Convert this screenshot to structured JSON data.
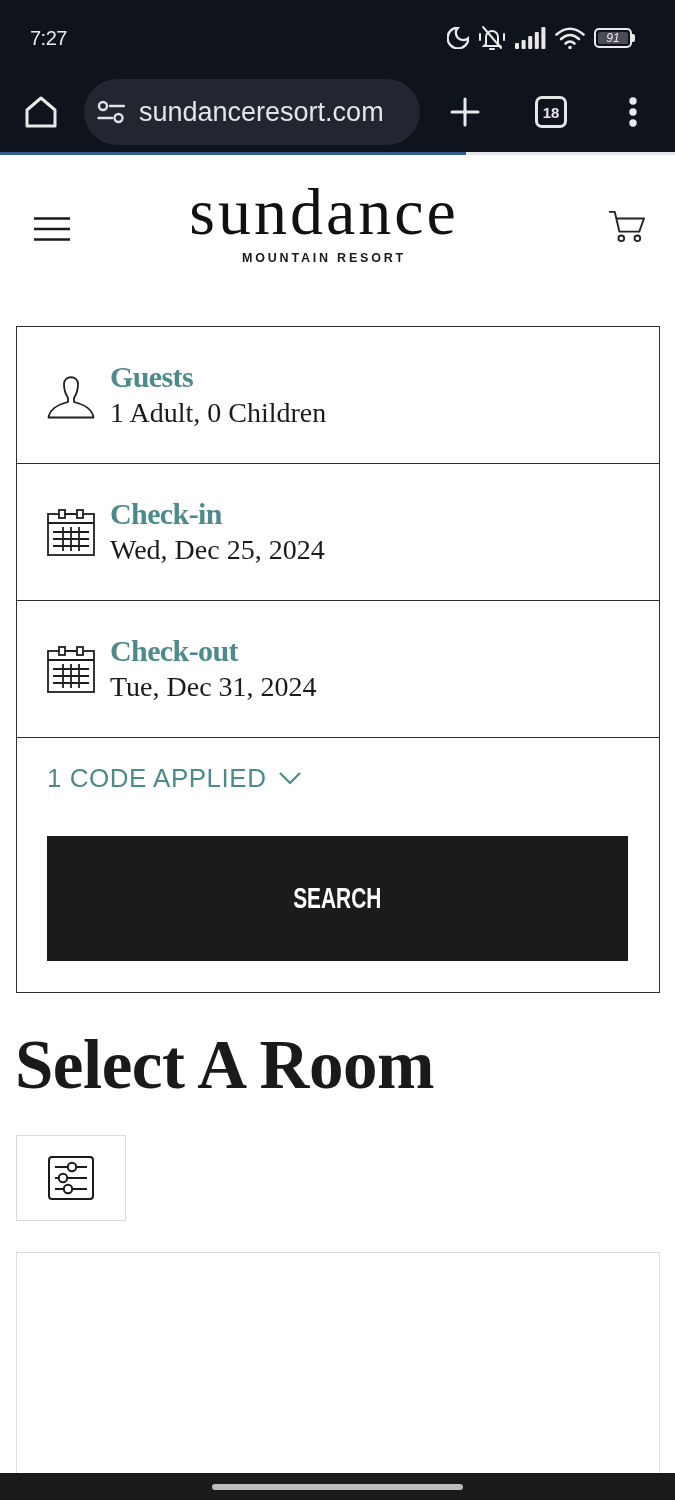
{
  "status_bar": {
    "time": "7:27",
    "battery": "91"
  },
  "browser": {
    "url": "sundanceresort.com",
    "tab_count": "18",
    "load_progress": {
      "level": 0.69
    }
  },
  "header": {
    "logo": "sundance",
    "tagline": "MOUNTAIN RESORT"
  },
  "booking": {
    "fields": [
      {
        "kind": "guests",
        "label": "Guests",
        "value": "1 Adult, 0 Children"
      },
      {
        "kind": "date",
        "label": "Check-in",
        "value": "Wed, Dec 25, 2024"
      },
      {
        "kind": "date",
        "label": "Check-out",
        "value": "Tue, Dec 31, 2024"
      }
    ],
    "promo": {
      "label": "1 CODE APPLIED",
      "expanded": false
    },
    "search_button": "SEARCH"
  },
  "room_section": {
    "title": "Select A Room"
  }
}
